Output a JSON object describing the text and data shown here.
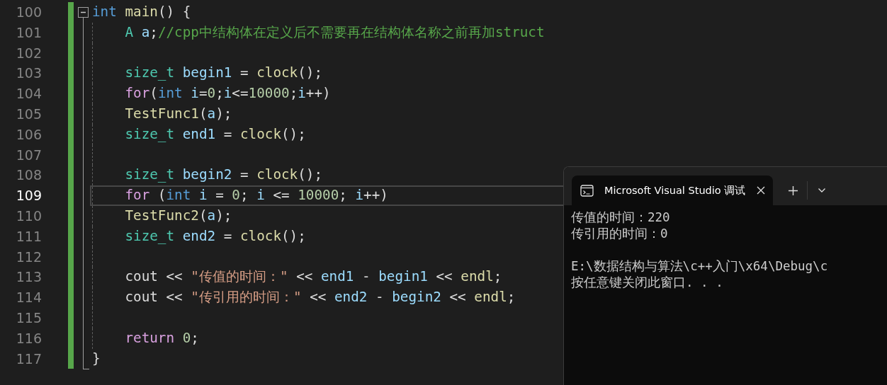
{
  "editor": {
    "fold": {
      "expanded": true
    },
    "lines": [
      {
        "number": "100",
        "current": false,
        "tokens": [
          {
            "kind": "keyword",
            "text": "int"
          },
          {
            "kind": "func",
            "text": " main"
          },
          {
            "kind": "plain",
            "text": "() {"
          }
        ]
      },
      {
        "number": "101",
        "current": false,
        "tokens": [
          {
            "kind": "type",
            "text": "    A"
          },
          {
            "kind": "var",
            "text": " a"
          },
          {
            "kind": "plain",
            "text": ";"
          },
          {
            "kind": "comment",
            "text": "//cpp中结构体在定义后不需要再在结构体名称之前再加struct"
          }
        ]
      },
      {
        "number": "102",
        "current": false
      },
      {
        "number": "103",
        "current": false,
        "tokens": [
          {
            "kind": "type",
            "text": "    size_t"
          },
          {
            "kind": "var",
            "text": " begin1"
          },
          {
            "kind": "plain",
            "text": " = "
          },
          {
            "kind": "func",
            "text": "clock"
          },
          {
            "kind": "plain",
            "text": "();"
          }
        ]
      },
      {
        "number": "104",
        "current": false,
        "tokens": [
          {
            "kind": "control",
            "text": "    for"
          },
          {
            "kind": "plain",
            "text": "("
          },
          {
            "kind": "keyword",
            "text": "int"
          },
          {
            "kind": "var",
            "text": " i"
          },
          {
            "kind": "plain",
            "text": "="
          },
          {
            "kind": "number",
            "text": "0"
          },
          {
            "kind": "plain",
            "text": ";"
          },
          {
            "kind": "var",
            "text": "i"
          },
          {
            "kind": "plain",
            "text": "<="
          },
          {
            "kind": "number",
            "text": "10000"
          },
          {
            "kind": "plain",
            "text": ";"
          },
          {
            "kind": "var",
            "text": "i"
          },
          {
            "kind": "plain",
            "text": "++)"
          }
        ]
      },
      {
        "number": "105",
        "current": false,
        "tokens": [
          {
            "kind": "func",
            "text": "    TestFunc1"
          },
          {
            "kind": "plain",
            "text": "("
          },
          {
            "kind": "var",
            "text": "a"
          },
          {
            "kind": "plain",
            "text": ");"
          }
        ]
      },
      {
        "number": "106",
        "current": false,
        "tokens": [
          {
            "kind": "type",
            "text": "    size_t"
          },
          {
            "kind": "var",
            "text": " end1"
          },
          {
            "kind": "plain",
            "text": " = "
          },
          {
            "kind": "func",
            "text": "clock"
          },
          {
            "kind": "plain",
            "text": "();"
          }
        ]
      },
      {
        "number": "107",
        "current": false
      },
      {
        "number": "108",
        "current": false,
        "tokens": [
          {
            "kind": "type",
            "text": "    size_t"
          },
          {
            "kind": "var",
            "text": " begin2"
          },
          {
            "kind": "plain",
            "text": " = "
          },
          {
            "kind": "func",
            "text": "clock"
          },
          {
            "kind": "plain",
            "text": "();"
          }
        ]
      },
      {
        "number": "109",
        "current": true,
        "tokens": [
          {
            "kind": "control",
            "text": "    for"
          },
          {
            "kind": "plain",
            "text": " ("
          },
          {
            "kind": "keyword",
            "text": "int"
          },
          {
            "kind": "var",
            "text": " i"
          },
          {
            "kind": "plain",
            "text": " = "
          },
          {
            "kind": "number",
            "text": "0"
          },
          {
            "kind": "plain",
            "text": "; "
          },
          {
            "kind": "var",
            "text": "i"
          },
          {
            "kind": "plain",
            "text": " <= "
          },
          {
            "kind": "number",
            "text": "10000"
          },
          {
            "kind": "plain",
            "text": "; "
          },
          {
            "kind": "var",
            "text": "i"
          },
          {
            "kind": "plain",
            "text": "++)"
          }
        ]
      },
      {
        "number": "110",
        "current": false,
        "tokens": [
          {
            "kind": "func",
            "text": "    TestFunc2"
          },
          {
            "kind": "plain",
            "text": "("
          },
          {
            "kind": "var",
            "text": "a"
          },
          {
            "kind": "plain",
            "text": ");"
          }
        ]
      },
      {
        "number": "111",
        "current": false,
        "tokens": [
          {
            "kind": "type",
            "text": "    size_t"
          },
          {
            "kind": "var",
            "text": " end2"
          },
          {
            "kind": "plain",
            "text": " = "
          },
          {
            "kind": "func",
            "text": "clock"
          },
          {
            "kind": "plain",
            "text": "();"
          }
        ]
      },
      {
        "number": "112",
        "current": false
      },
      {
        "number": "113",
        "current": false,
        "tokens": [
          {
            "kind": "plain",
            "text": "    cout << "
          },
          {
            "kind": "string",
            "text": "\"传值的时间：\""
          },
          {
            "kind": "plain",
            "text": " << "
          },
          {
            "kind": "var",
            "text": "end1"
          },
          {
            "kind": "plain",
            "text": " - "
          },
          {
            "kind": "var",
            "text": "begin1"
          },
          {
            "kind": "plain",
            "text": " << "
          },
          {
            "kind": "func",
            "text": "endl"
          },
          {
            "kind": "plain",
            "text": ";"
          }
        ]
      },
      {
        "number": "114",
        "current": false,
        "tokens": [
          {
            "kind": "plain",
            "text": "    cout << "
          },
          {
            "kind": "string",
            "text": "\"传引用的时间：\""
          },
          {
            "kind": "plain",
            "text": " << "
          },
          {
            "kind": "var",
            "text": "end2"
          },
          {
            "kind": "plain",
            "text": " - "
          },
          {
            "kind": "var",
            "text": "begin2"
          },
          {
            "kind": "plain",
            "text": " << "
          },
          {
            "kind": "func",
            "text": "endl"
          },
          {
            "kind": "plain",
            "text": ";"
          }
        ]
      },
      {
        "number": "115",
        "current": false
      },
      {
        "number": "116",
        "current": false,
        "tokens": [
          {
            "kind": "control",
            "text": "    return"
          },
          {
            "kind": "number",
            "text": " 0"
          },
          {
            "kind": "plain",
            "text": ";"
          }
        ]
      },
      {
        "number": "117",
        "current": false,
        "tokens": [
          {
            "kind": "plain",
            "text": "}"
          }
        ]
      }
    ]
  },
  "console": {
    "tabs": [
      {
        "title": "Microsoft Visual Studio 调试",
        "selected": true
      }
    ],
    "output": [
      [
        "传值的时间：220",
        "传引用的时间：0"
      ],
      [
        "E:\\数据结构与算法\\c++入门\\x64\\Debug\\c",
        "按任意键关闭此窗口. . ."
      ]
    ]
  }
}
